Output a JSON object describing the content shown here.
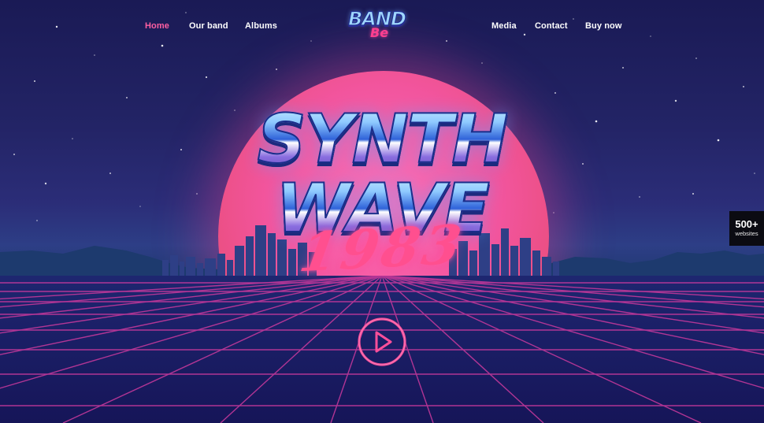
{
  "nav": {
    "left": [
      {
        "label": "Home",
        "active": true
      },
      {
        "label": "Our band",
        "active": false
      },
      {
        "label": "Albums",
        "active": false
      }
    ],
    "right": [
      {
        "label": "Media",
        "active": false
      },
      {
        "label": "Contact",
        "active": false
      },
      {
        "label": "Buy now",
        "active": false
      }
    ]
  },
  "logo": {
    "main": "BAND",
    "sub": "Be"
  },
  "hero": {
    "line1": "SYNTH",
    "line2": "WAVE",
    "year": "1983"
  },
  "play": {
    "icon": "play-icon"
  },
  "badge": {
    "count": "500+",
    "label": "websites"
  },
  "colors": {
    "nav_active": "#ff5fa2",
    "sun": "#f2559e",
    "grid_line": "#c2389a",
    "sky": "#232466",
    "badge_bg": "#0b0b12"
  }
}
